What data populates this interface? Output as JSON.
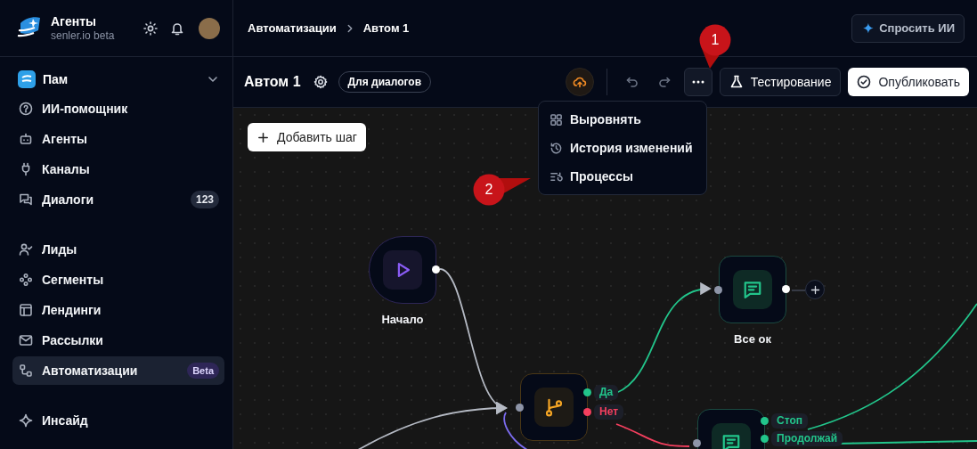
{
  "sidebar": {
    "brand": {
      "title": "Агенты",
      "subtitle": "senler.io beta"
    },
    "workspace": {
      "name": "Пам"
    },
    "groups": [
      {
        "items": [
          {
            "label": "ИИ-помощник",
            "selected": false
          },
          {
            "label": "Агенты",
            "selected": false
          },
          {
            "label": "Каналы",
            "selected": false
          },
          {
            "label": "Диалоги",
            "selected": false,
            "badge": {
              "text": "123",
              "kind": "count"
            }
          }
        ]
      },
      {
        "items": [
          {
            "label": "Лиды",
            "selected": false
          },
          {
            "label": "Сегменты",
            "selected": false
          },
          {
            "label": "Лендинги",
            "selected": false
          },
          {
            "label": "Рассылки",
            "selected": false
          },
          {
            "label": "Автоматизации",
            "selected": true,
            "badge": {
              "text": "Beta",
              "kind": "beta"
            }
          }
        ]
      },
      {
        "items": [
          {
            "label": "Инсайд",
            "selected": false
          }
        ]
      }
    ]
  },
  "header": {
    "breadcrumb": [
      "Автоматизации",
      "Автом 1"
    ],
    "ask_ai_button": "Спросить ИИ"
  },
  "toolbar": {
    "title": "Автом 1",
    "tag": "Для диалогов",
    "testing_button": "Тестирование",
    "publish_button": "Опубликовать"
  },
  "more_menu": {
    "open": true,
    "items": [
      "Выровнять",
      "История изменений",
      "Процессы"
    ]
  },
  "canvas": {
    "add_step_button": "Добавить шаг",
    "nodes": [
      {
        "kind": "start",
        "label": "Начало"
      },
      {
        "kind": "condition",
        "outputs": [
          {
            "label": "Да",
            "color": "#22c58b"
          },
          {
            "label": "Нет",
            "color": "#f43f5e"
          }
        ]
      },
      {
        "kind": "message",
        "label": "Все ок"
      },
      {
        "kind": "message",
        "outputs": [
          {
            "label": "Стоп",
            "color": "#22c58b"
          },
          {
            "label": "Продолжай",
            "color": "#22c58b"
          }
        ]
      }
    ]
  },
  "annotations": [
    "1",
    "2"
  ]
}
